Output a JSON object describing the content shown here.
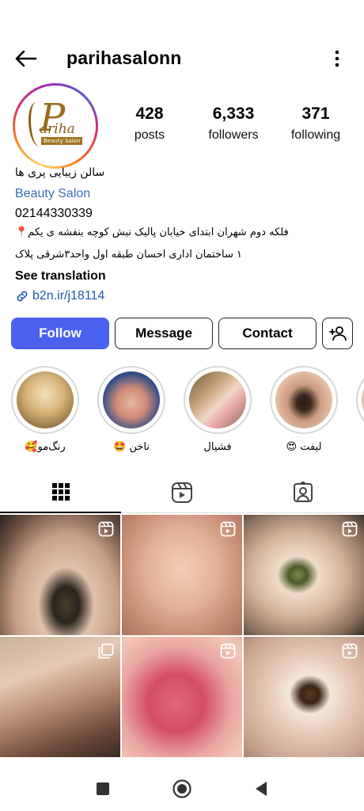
{
  "header": {
    "username": "parihasalonn"
  },
  "avatar": {
    "logo_letter": "P",
    "logo_word": "ariha",
    "logo_sub": "Beauty Salon"
  },
  "stats": {
    "posts_count": "428",
    "posts_label": "posts",
    "followers_count": "6,333",
    "followers_label": "followers",
    "following_count": "371",
    "following_label": "following"
  },
  "bio": {
    "name": "سالن زیبایی پری ها",
    "category": "Beauty Salon",
    "phone": "02144330339",
    "address_line1": "فلکه دوم شهران ابتدای خیابان پالیک نبش کوچه بنفشه ی یکم📍",
    "address_line2": "۱ ساختمان اداری احسان طبقه اول واحد۳شرقی پلاک",
    "see_translation": "See translation",
    "link": "b2n.ir/j18114"
  },
  "actions": {
    "follow": "Follow",
    "message": "Message",
    "contact": "Contact"
  },
  "highlights": [
    {
      "label": "رنگ‌مو🥰"
    },
    {
      "label": "ناخن 🤩"
    },
    {
      "label": "فشیال"
    },
    {
      "label": "لیفت 😍"
    }
  ],
  "colors": {
    "follow_button": "#4a61f0",
    "link": "#1c5aa8",
    "category": "#3b6fb6"
  },
  "icons": {
    "back": "arrow-left",
    "more": "vertical-dots",
    "suggest": "person-add",
    "tab_grid": "grid",
    "tab_reels": "reels",
    "tab_tagged": "person-tag",
    "link": "chain-link",
    "nav_recents": "square",
    "nav_home": "circle",
    "nav_back": "triangle-left"
  }
}
